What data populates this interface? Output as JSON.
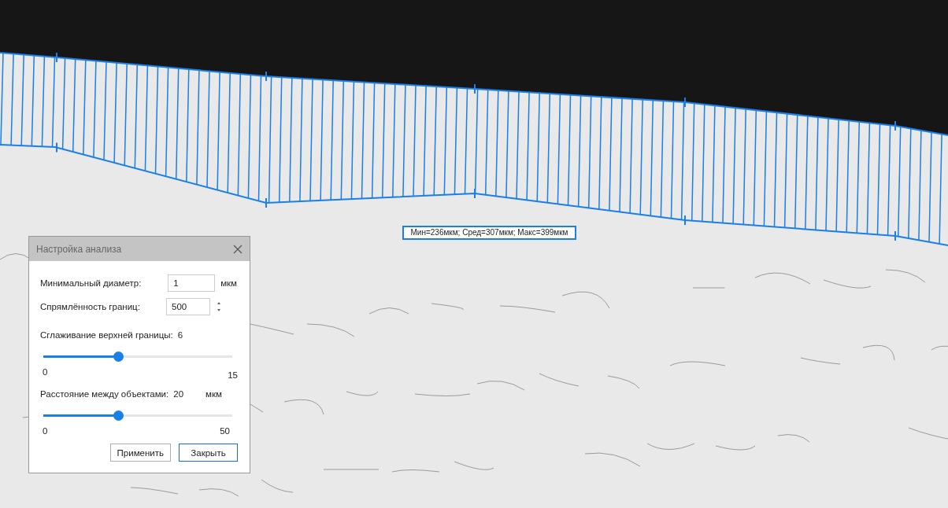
{
  "measurement_label": "Мин=236мкм; Сред=307мкм; Макс=399мкм",
  "dialog": {
    "title": "Настройка анализа",
    "min_diameter": {
      "label": "Минимальный диаметр:",
      "value": "1",
      "unit": "мкм"
    },
    "straightness": {
      "label": "Спрямлённость границ:",
      "value": "500"
    },
    "smoothing": {
      "label": "Сглаживание верхней границы:",
      "value": "6",
      "level": 0.4,
      "min": "0",
      "max": "15"
    },
    "distance": {
      "label": "Расстояние между объектами:",
      "value": "20",
      "unit": "мкм",
      "level": 0.4,
      "min": "0",
      "max": "50"
    },
    "buttons": [
      {
        "label": "Применить",
        "kind": "apply"
      },
      {
        "label": "Закрыть",
        "kind": "close"
      }
    ]
  }
}
